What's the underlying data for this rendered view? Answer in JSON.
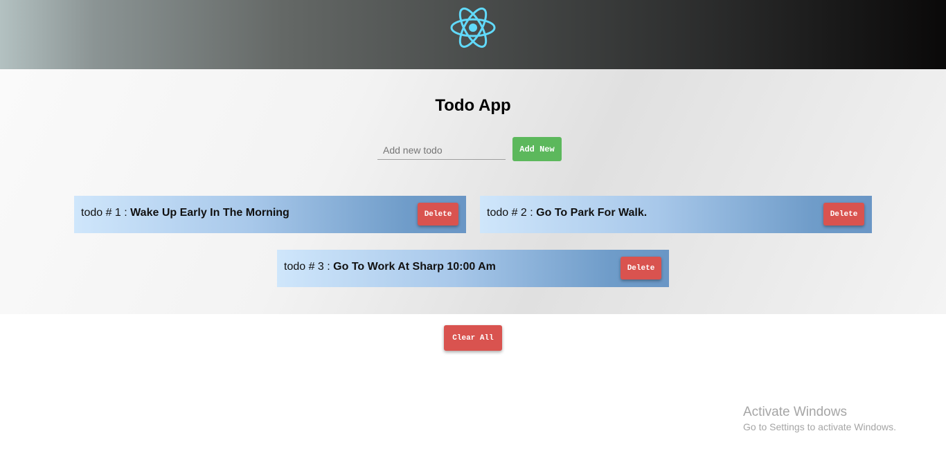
{
  "header": {
    "logo_icon": "react-atom-icon",
    "logo_color": "#61dafb"
  },
  "main": {
    "title": "Todo App",
    "input": {
      "placeholder": "Add new todo",
      "value": ""
    },
    "add_button_label": "Add New",
    "todos": [
      {
        "prefix": "todo # 1 :",
        "task": "Wake Up Early In The Morning",
        "delete_label": "Delete"
      },
      {
        "prefix": "todo # 2 :",
        "task": "Go To Park For Walk.",
        "delete_label": "Delete"
      },
      {
        "prefix": "todo # 3 :",
        "task": "Go To Work At Sharp 10:00 Am",
        "delete_label": "Delete"
      }
    ]
  },
  "clear_all_label": "Clear All",
  "watermark": {
    "title": "Activate Windows",
    "subtitle": "Go to Settings to activate Windows."
  },
  "colors": {
    "add_button": "#5cb85c",
    "delete_button": "#d9534f",
    "card_gradient_start": "#cfe6fb",
    "card_gradient_end": "#6a96c5"
  }
}
